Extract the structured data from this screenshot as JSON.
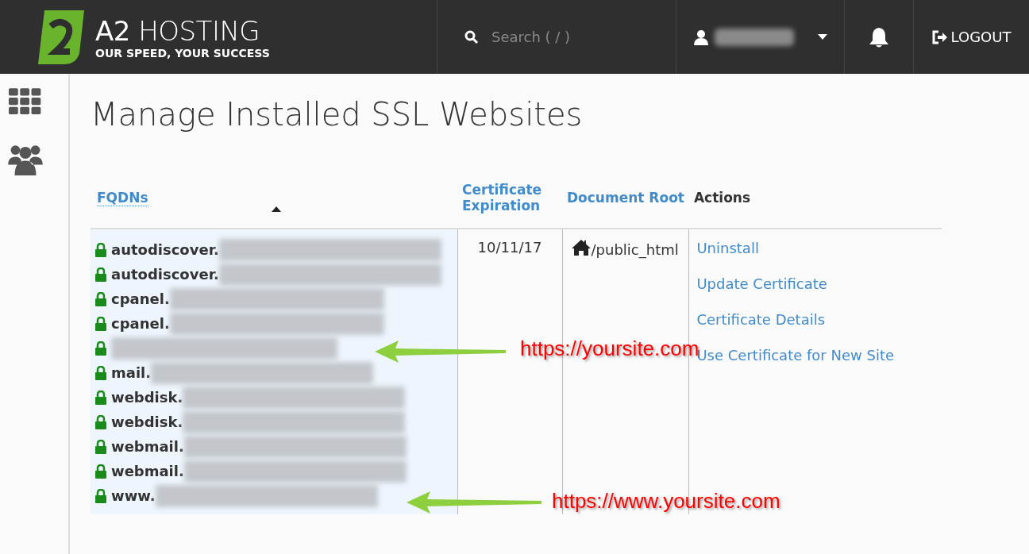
{
  "header": {
    "brand": "**A2** HOSTING",
    "tagline": "OUR SPEED, YOUR SUCCESS",
    "search": {
      "placeholder": "Search ( / )"
    },
    "logout": "LOGOUT"
  },
  "page_title": "Manage Installed SSL Websites",
  "table": {
    "columns": [
      {
        "label": "FQDNs",
        "kind": "sortable",
        "sort_ascending": true
      },
      {
        "label": "Certificate Expiration",
        "kind": "link"
      },
      {
        "label": "Document Root",
        "kind": "link"
      },
      {
        "label": "Actions",
        "kind": "plain"
      }
    ],
    "fqdns": [
      {
        "kind": "prefixed",
        "prefix": "autodiscover."
      },
      {
        "kind": "prefixed",
        "prefix": "autodiscover."
      },
      {
        "kind": "prefixed",
        "prefix": "cpanel."
      },
      {
        "kind": "prefixed",
        "prefix": "cpanel."
      },
      {
        "kind": "redacted"
      },
      {
        "kind": "prefixed",
        "prefix": "mail."
      },
      {
        "kind": "prefixed",
        "prefix": "webdisk."
      },
      {
        "kind": "prefixed",
        "prefix": "webdisk."
      },
      {
        "kind": "prefixed",
        "prefix": "webmail."
      },
      {
        "kind": "prefixed",
        "prefix": "webmail."
      },
      {
        "kind": "prefixed",
        "prefix": "www."
      }
    ],
    "expiration": "10/11/17",
    "document_root": "/public_html",
    "actions": [
      "Uninstall",
      "Update Certificate",
      "Certificate Details",
      "Use Certificate for New Site"
    ]
  },
  "annotations": [
    {
      "label": "https://yoursite.com"
    },
    {
      "label": "https://www.yoursite.com"
    }
  ]
}
